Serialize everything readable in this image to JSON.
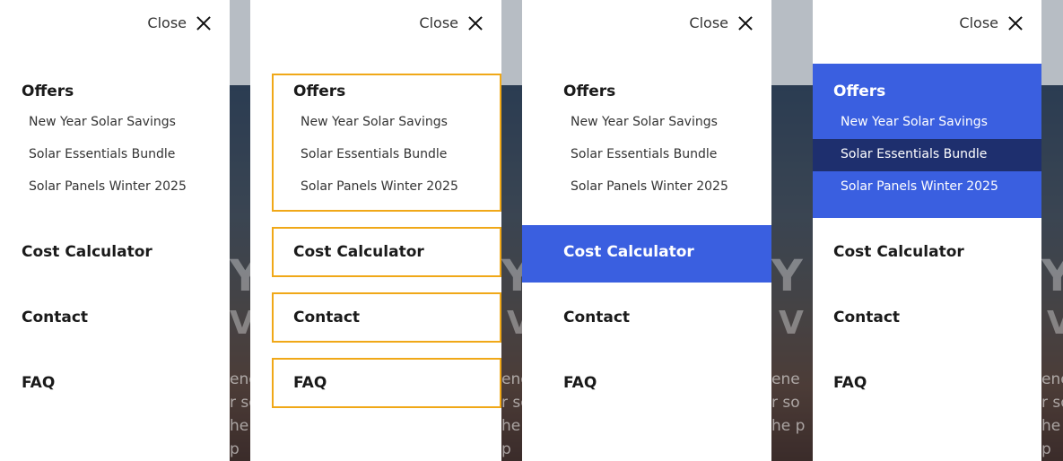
{
  "drawer": {
    "close_label": "Close",
    "menu": {
      "offers": {
        "label": "Offers",
        "items": [
          "New Year Solar Savings",
          "Solar Essentials Bundle",
          "Solar Panels Winter 2025"
        ]
      },
      "cost_calculator": "Cost Calculator",
      "contact": "Contact",
      "faq": "FAQ"
    }
  },
  "colors": {
    "active_blue": "#3a5fe0",
    "active_dark": "#1e2f6e",
    "focus_outline": "#f0a818"
  },
  "icons": [
    "close-icon"
  ]
}
